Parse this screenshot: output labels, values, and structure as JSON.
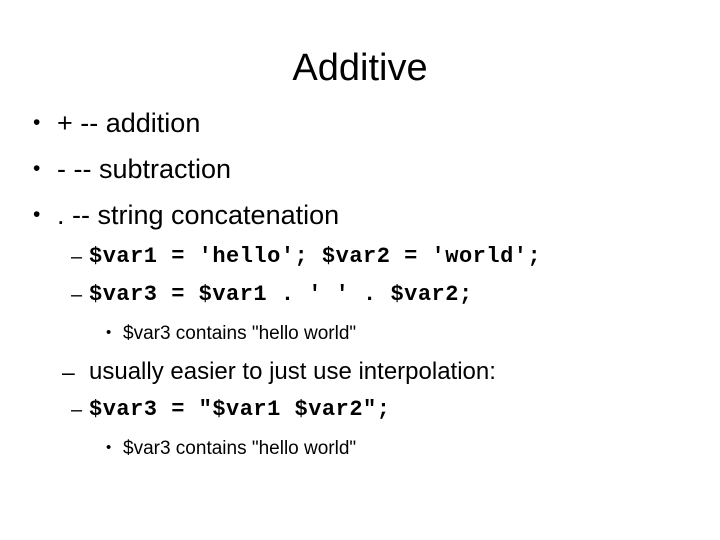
{
  "slide": {
    "title": "Additive",
    "background_color": "#ffffff",
    "text_color": "#000000",
    "bullets": [
      {
        "level": 1,
        "marker": "•",
        "style": "sans",
        "text": "+ -- addition"
      },
      {
        "level": 1,
        "marker": "•",
        "style": "sans",
        "text": "- -- subtraction"
      },
      {
        "level": 1,
        "marker": "•",
        "style": "sans",
        "text": ". -- string concatenation"
      },
      {
        "level": 2,
        "marker": "–",
        "style": "code",
        "text": "$var1 = 'hello'; $var2 = 'world';"
      },
      {
        "level": 2,
        "marker": "–",
        "style": "code",
        "text": "$var3 = $var1 . ' ' . $var2;"
      },
      {
        "level": 3,
        "marker": "•",
        "style": "sans",
        "text": "$var3 contains \"hello world\""
      },
      {
        "level": 2,
        "marker": "–",
        "style": "prose",
        "text": "usually easier to just use interpolation:"
      },
      {
        "level": 2,
        "marker": "–",
        "style": "code",
        "text": "$var3 = \"$var1 $var2\";"
      },
      {
        "level": 3,
        "marker": "•",
        "style": "sans",
        "text": "$var3 contains \"hello world\""
      }
    ]
  }
}
